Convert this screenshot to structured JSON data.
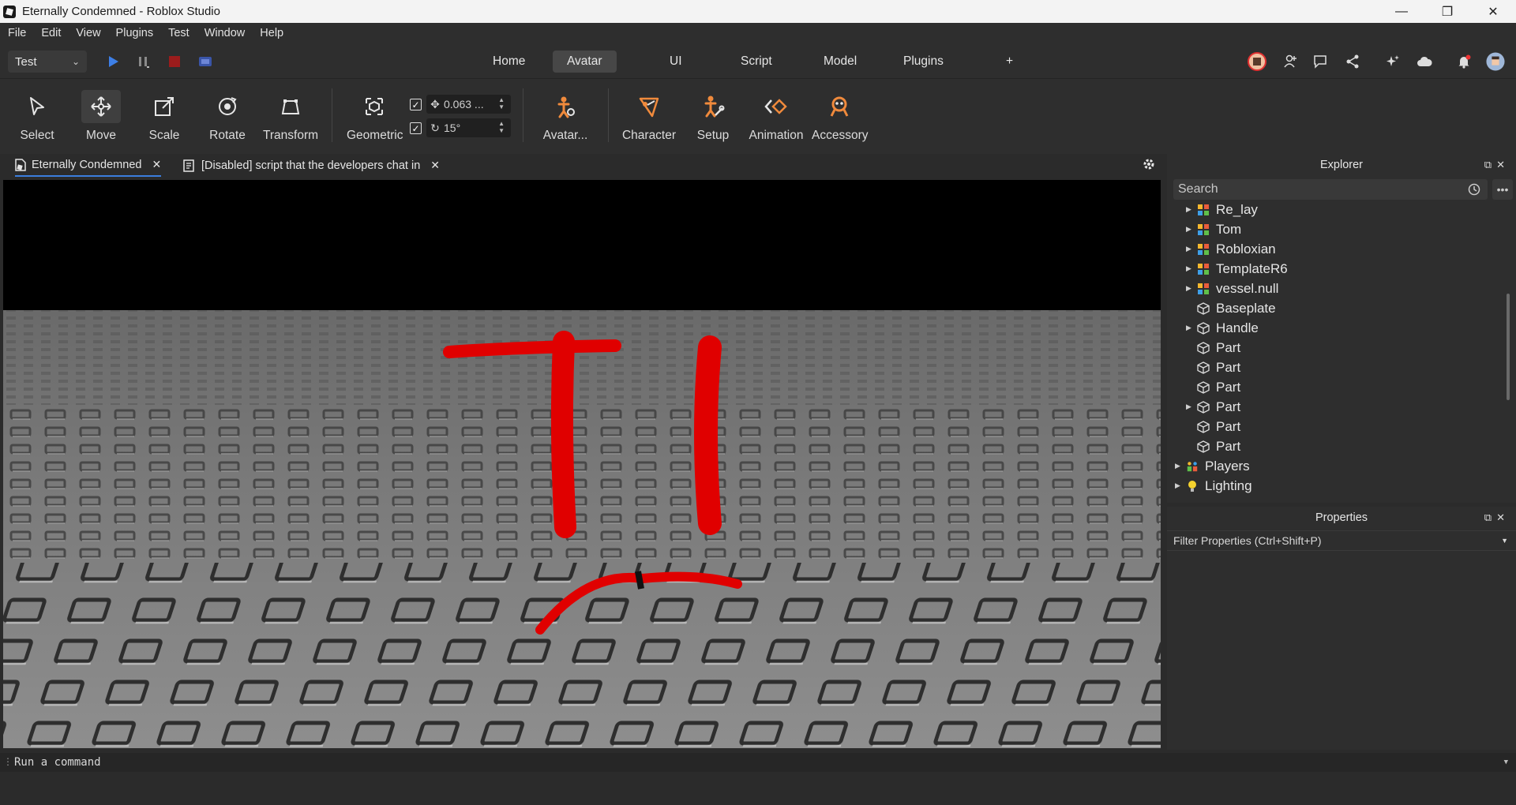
{
  "window": {
    "title": "Eternally Condemned - Roblox Studio"
  },
  "menubar": {
    "items": [
      "File",
      "Edit",
      "View",
      "Plugins",
      "Test",
      "Window",
      "Help"
    ]
  },
  "topbar": {
    "mode": "Test",
    "tabs": [
      "Home",
      "Avatar",
      "UI",
      "Script",
      "Model",
      "Plugins",
      "+"
    ],
    "active_tab": "Avatar"
  },
  "ribbon": {
    "tools": {
      "select": "Select",
      "move": "Move",
      "scale": "Scale",
      "rotate": "Rotate",
      "transform": "Transform",
      "geometric": "Geometric",
      "avatar": "Avatar...",
      "character": "Character",
      "setup": "Setup",
      "animation": "Animation",
      "accessory": "Accessory"
    },
    "move_snap": "0.063 ...",
    "rotate_snap": "15°",
    "accent_color": "#f08a3c"
  },
  "doc_tabs": {
    "place": "Eternally Condemned",
    "script": "[Disabled] script that the developers chat in"
  },
  "explorer": {
    "title": "Explorer",
    "search_placeholder": "Search",
    "items": [
      "Re_lay",
      "Tom",
      "Robloxian",
      "TemplateR6",
      "vessel.null",
      "Baseplate",
      "Handle",
      "Part",
      "Part",
      "Part",
      "Part",
      "Part",
      "Part",
      "Players",
      "Lighting"
    ]
  },
  "properties": {
    "title": "Properties",
    "filter_placeholder": "Filter Properties (Ctrl+Shift+P)"
  },
  "command_bar": {
    "placeholder": "Run a command"
  },
  "colors": {
    "tab_active_underline": "#3b7ddd",
    "stop_red": "#9b1c1c",
    "play_blue": "#3d7fe6",
    "drawing_red": "#e00000"
  }
}
